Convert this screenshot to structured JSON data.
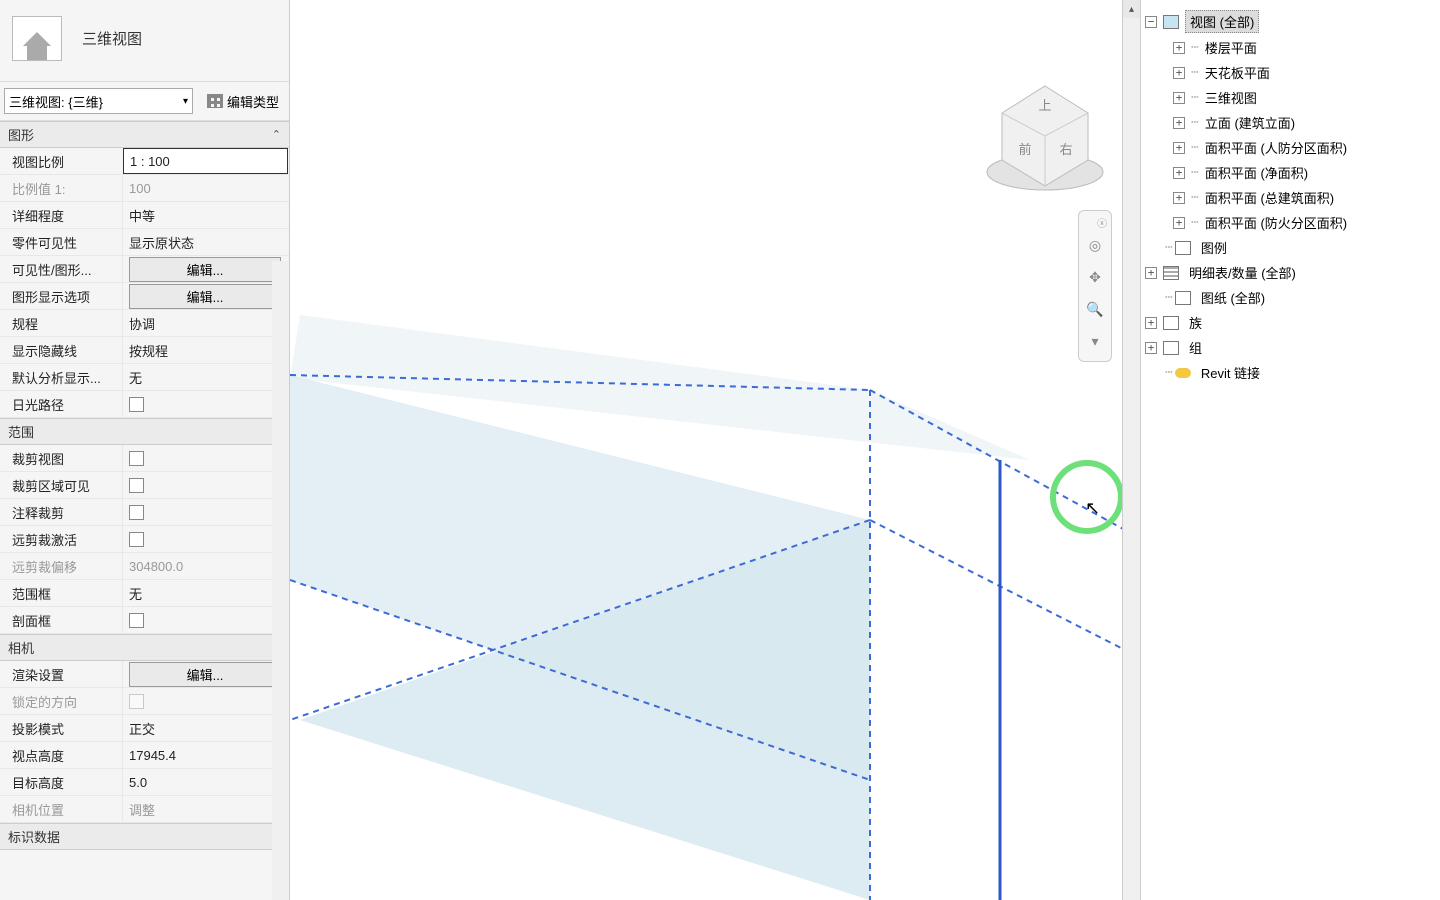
{
  "header": {
    "title": "三维视图"
  },
  "filter": {
    "value": "三维视图: {三维}",
    "editTypeBtn": "编辑类型"
  },
  "sections": {
    "graphics": {
      "title": "图形",
      "rows": [
        {
          "label": "视图比例",
          "value": "1 : 100",
          "kind": "input"
        },
        {
          "label": "比例值 1:",
          "value": "100",
          "kind": "disabled"
        },
        {
          "label": "详细程度",
          "value": "中等",
          "kind": "text"
        },
        {
          "label": "零件可见性",
          "value": "显示原状态",
          "kind": "text"
        },
        {
          "label": "可见性/图形...",
          "value": "编辑...",
          "kind": "button"
        },
        {
          "label": "图形显示选项",
          "value": "编辑...",
          "kind": "button"
        },
        {
          "label": "规程",
          "value": "协调",
          "kind": "text"
        },
        {
          "label": "显示隐藏线",
          "value": "按规程",
          "kind": "text"
        },
        {
          "label": "默认分析显示...",
          "value": "无",
          "kind": "text"
        },
        {
          "label": "日光路径",
          "value": "",
          "kind": "checkbox"
        }
      ]
    },
    "extents": {
      "title": "范围",
      "rows": [
        {
          "label": "裁剪视图",
          "value": "",
          "kind": "checkbox"
        },
        {
          "label": "裁剪区域可见",
          "value": "",
          "kind": "checkbox"
        },
        {
          "label": "注释裁剪",
          "value": "",
          "kind": "checkbox"
        },
        {
          "label": "远剪裁激活",
          "value": "",
          "kind": "checkbox"
        },
        {
          "label": "远剪裁偏移",
          "value": "304800.0",
          "kind": "disabled"
        },
        {
          "label": "范围框",
          "value": "无",
          "kind": "text"
        },
        {
          "label": "剖面框",
          "value": "",
          "kind": "checkbox"
        }
      ]
    },
    "camera": {
      "title": "相机",
      "rows": [
        {
          "label": "渲染设置",
          "value": "编辑...",
          "kind": "button"
        },
        {
          "label": "锁定的方向",
          "value": "",
          "kind": "checkbox-disabled"
        },
        {
          "label": "投影模式",
          "value": "正交",
          "kind": "text"
        },
        {
          "label": "视点高度",
          "value": "17945.4",
          "kind": "text"
        },
        {
          "label": "目标高度",
          "value": "5.0",
          "kind": "text"
        },
        {
          "label": "相机位置",
          "value": "调整",
          "kind": "disabled"
        }
      ]
    },
    "identity": {
      "title": "标识数据"
    }
  },
  "viewcube": {
    "top": "上",
    "front": "前",
    "right": "右"
  },
  "browser": {
    "root": "视图 (全部)",
    "views": [
      "楼层平面",
      "天花板平面",
      "三维视图",
      "立面 (建筑立面)",
      "面积平面 (人防分区面积)",
      "面积平面 (净面积)",
      "面积平面 (总建筑面积)",
      "面积平面 (防火分区面积)"
    ],
    "legends": "图例",
    "schedules": "明细表/数量 (全部)",
    "sheets": "图纸 (全部)",
    "families": "族",
    "groups": "组",
    "links": "Revit 链接"
  }
}
